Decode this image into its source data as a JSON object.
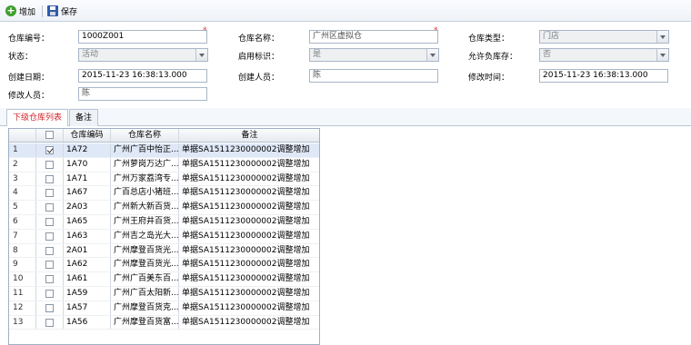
{
  "toolbar": {
    "add_label": "增加",
    "save_label": "保存"
  },
  "form": {
    "warehouse_code_label": "仓库编号：",
    "warehouse_code_value": "1000Z001",
    "warehouse_name_label": "仓库名称：",
    "warehouse_name_value": "广州区虚拟仓",
    "warehouse_type_label": "仓库类型：",
    "warehouse_type_value": "门店",
    "status_label": "状态：",
    "status_value": "活动",
    "enabled_label": "启用标识：",
    "enabled_value": "是",
    "allow_negative_label": "允许负库存：",
    "allow_negative_value": "否",
    "created_date_label": "创建日期：",
    "created_date_value": "2015-11-23 16:38:13.000",
    "creator_label": "创建人员：",
    "creator_value": "陈",
    "modified_time_label": "修改时间：",
    "modified_time_value": "2015-11-23 16:38:13.000",
    "modifier_label": "修改人员：",
    "modifier_value": "陈"
  },
  "tabs": [
    {
      "label": "下级仓库列表"
    },
    {
      "label": "备注"
    }
  ],
  "grid": {
    "columns": [
      "",
      "仓库编码",
      "仓库名称",
      "备注"
    ],
    "rows": [
      {
        "num": "1",
        "checked": true,
        "code": "1A72",
        "name": "广州广百中怡正...",
        "note": "单据SA1511230000002调整增加"
      },
      {
        "num": "2",
        "checked": false,
        "code": "1A70",
        "name": "广州萝岗万达广...",
        "note": "单据SA1511230000002调整增加"
      },
      {
        "num": "3",
        "checked": false,
        "code": "1A71",
        "name": "广州万家荔湾专...",
        "note": "单据SA1511230000002调整增加"
      },
      {
        "num": "4",
        "checked": false,
        "code": "1A67",
        "name": "广百总店小猪班...",
        "note": "单据SA1511230000002调整增加"
      },
      {
        "num": "5",
        "checked": false,
        "code": "2A03",
        "name": "广州新大新百货...",
        "note": "单据SA1511230000002调整增加"
      },
      {
        "num": "6",
        "checked": false,
        "code": "1A65",
        "name": "广州王府井百货...",
        "note": "单据SA1511230000002调整增加"
      },
      {
        "num": "7",
        "checked": false,
        "code": "1A63",
        "name": "广州吉之岛光大...",
        "note": "单据SA1511230000002调整增加"
      },
      {
        "num": "8",
        "checked": false,
        "code": "2A01",
        "name": "广州摩登百货光...",
        "note": "单据SA1511230000002调整增加"
      },
      {
        "num": "9",
        "checked": false,
        "code": "1A62",
        "name": "广州摩登百货光...",
        "note": "单据SA1511230000002调整增加"
      },
      {
        "num": "10",
        "checked": false,
        "code": "1A61",
        "name": "广州广百美东百...",
        "note": "单据SA1511230000002调整增加"
      },
      {
        "num": "11",
        "checked": false,
        "code": "1A59",
        "name": "广州广百太阳新...",
        "note": "单据SA1511230000002调整增加"
      },
      {
        "num": "12",
        "checked": false,
        "code": "1A57",
        "name": "广州摩登百货克...",
        "note": "单据SA1511230000002调整增加"
      },
      {
        "num": "13",
        "checked": false,
        "code": "1A56",
        "name": "广州摩登百货富...",
        "note": "单据SA1511230000002调整增加"
      }
    ]
  },
  "colors": {
    "accent_tab": "#d2232a",
    "required_mark": "#e03030",
    "selected_row": "#dfe8f6"
  }
}
